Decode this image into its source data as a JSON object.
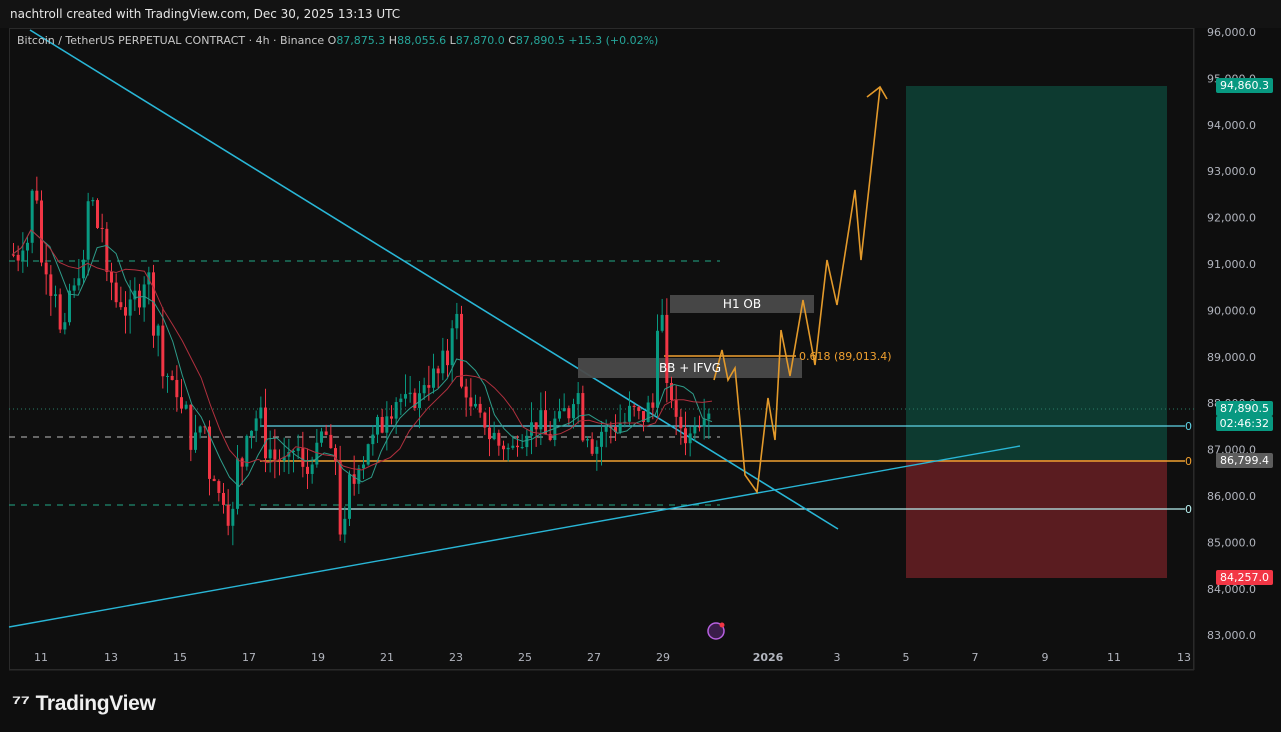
{
  "header": {
    "publisher_text": "nachtroll created with TradingView.com, Dec 30, 2025 13:13 UTC"
  },
  "legend": {
    "symbol": "Bitcoin / TetherUS PERPETUAL CONTRACT · 4h · Binance",
    "open_label": "O",
    "open": "87,875.3",
    "high_label": "H",
    "high": "88,055.6",
    "low_label": "L",
    "low": "87,870.0",
    "close_label": "C",
    "close": "87,890.5",
    "change": "+15.3 (+0.02%)"
  },
  "price_axis": {
    "ticks": [
      "96,000.0",
      "95,000.0",
      "94,000.0",
      "93,000.0",
      "92,000.0",
      "91,000.0",
      "90,000.0",
      "89,000.0",
      "88,000.0",
      "87,000.0",
      "86,000.0",
      "85,000.0",
      "84,000.0",
      "83,000.0"
    ],
    "target_label": "94,860.3",
    "last_price_label": "87,890.5",
    "countdown_label": "02:46:32",
    "marked_level_label": "86,799.4",
    "stop_label": "84,257.0",
    "colors": {
      "target": "#089981",
      "last": "#089981",
      "marked": "#5d5d5d",
      "stop": "#f23645"
    }
  },
  "time_axis": {
    "ticks": [
      "11",
      "13",
      "15",
      "17",
      "19",
      "21",
      "23",
      "25",
      "27",
      "29",
      "2026",
      "3",
      "5",
      "7",
      "9",
      "11",
      "13"
    ]
  },
  "annotations": {
    "h1_ob": "H1 OB",
    "bb_ifvg": "BB + IFVG",
    "fib_label": "0.618 (89,013.4)",
    "zero_labels": [
      "0",
      "0",
      "0"
    ]
  },
  "colors": {
    "up": "#089981",
    "down": "#f23645",
    "trendline": "#29b6d6",
    "orange": "#f0a030",
    "projection": "#e39a2b",
    "target_zone": "#0d3a30",
    "stop_zone": "#5a1c20"
  },
  "branding": {
    "logo_text": "TradingView"
  }
}
